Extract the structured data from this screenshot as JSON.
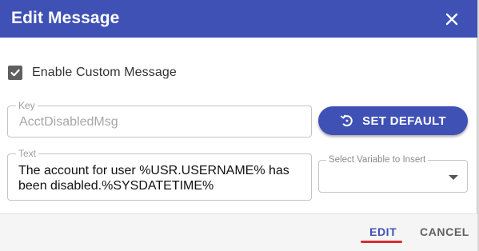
{
  "dialog": {
    "title": "Edit Message",
    "close_icon": "close-icon"
  },
  "enable_custom": {
    "label": "Enable Custom Message",
    "checked": true,
    "icon": "checkbox-checked-icon"
  },
  "key_field": {
    "label": "Key",
    "value": "AcctDisabledMsg"
  },
  "set_default": {
    "label": "SET DEFAULT",
    "icon": "restore-icon"
  },
  "text_field": {
    "label": "Text",
    "value": "The account for user %USR.USERNAME% has been disabled.%SYSDATETIME%"
  },
  "variable_select": {
    "label": "Select Variable to Insert",
    "value": "",
    "icon": "dropdown-arrow-icon"
  },
  "footer": {
    "edit_label": "EDIT",
    "cancel_label": "CANCEL"
  },
  "colors": {
    "primary": "#3f51b5",
    "accent_underline": "#d32f2f",
    "checkbox": "#5f5f5f"
  }
}
